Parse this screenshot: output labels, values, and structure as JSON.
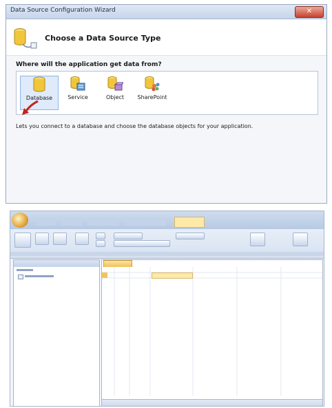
{
  "wizard": {
    "window_title": "Data Source Configuration Wizard",
    "header_title": "Choose a Data Source Type",
    "question": "Where will the application get data from?",
    "choices": [
      {
        "label": "Database",
        "icon": "database-icon",
        "selected": true
      },
      {
        "label": "Service",
        "icon": "service-icon",
        "selected": false
      },
      {
        "label": "Object",
        "icon": "object-icon",
        "selected": false
      },
      {
        "label": "SharePoint",
        "icon": "sharepoint-icon",
        "selected": false
      }
    ],
    "description": "Lets you connect to a database and choose the database objects for your application."
  },
  "colors": {
    "selection": "#dfeafa",
    "close_button": "#c8412e",
    "ribbon": "#d6e1f1",
    "active_tab": "#fde9a8"
  }
}
